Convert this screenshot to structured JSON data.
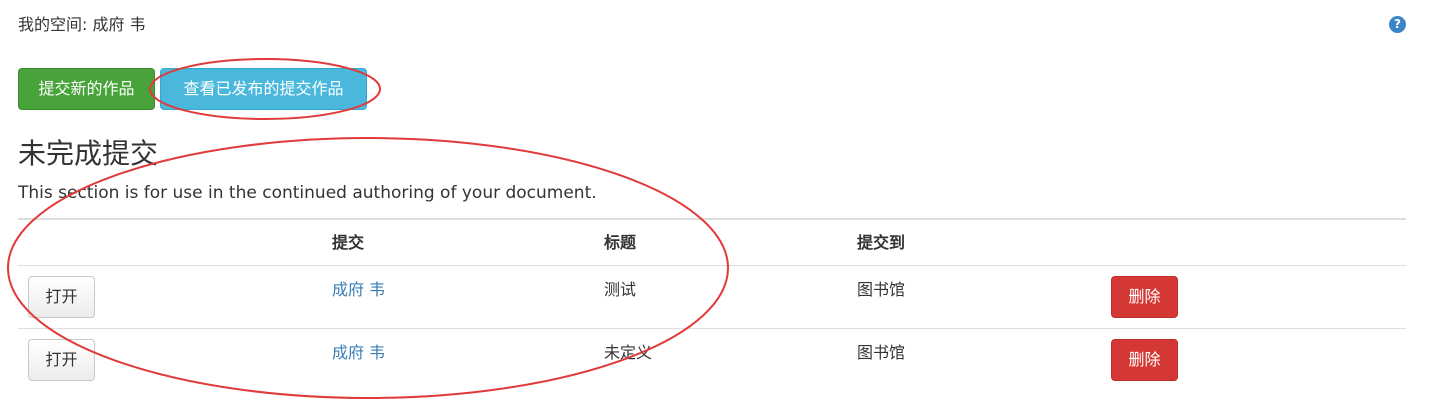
{
  "header": {
    "space_label": "我的空间: 成府 韦",
    "help_icon": "question-circle-icon",
    "help_glyph": "?"
  },
  "toolbar": {
    "new_submission_label": "提交新的作品",
    "view_published_label": "查看已发布的提交作品"
  },
  "section": {
    "title": "未完成提交",
    "description": "This section is for use in the continued authoring of your document."
  },
  "table": {
    "columns": [
      "",
      "提交",
      "标题",
      "提交到",
      ""
    ],
    "rows": [
      {
        "open_label": "打开",
        "submitter": "成府 韦",
        "title": "测试",
        "destination": "图书馆",
        "delete_label": "删除"
      },
      {
        "open_label": "打开",
        "submitter": "成府 韦",
        "title": "未定义",
        "destination": "图书馆",
        "delete_label": "删除"
      }
    ]
  },
  "colors": {
    "success": "#48a43a",
    "info": "#4ab8dc",
    "danger": "#d43834",
    "link": "#3a7fb5",
    "annotation": "#e03a3a"
  }
}
